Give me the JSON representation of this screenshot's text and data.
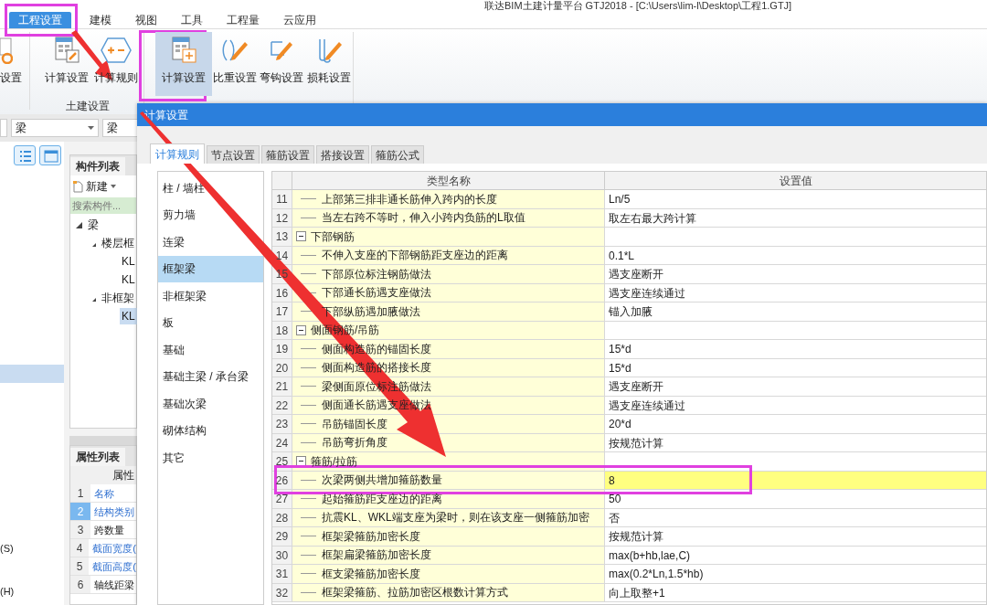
{
  "window": {
    "title": "联达BIM土建计量平台 GTJ2018 - [C:\\Users\\lim-l\\Desktop\\工程1.GTJ]"
  },
  "ribbon_tabs": [
    {
      "label": "工程设置",
      "selected": true
    },
    {
      "label": "建模",
      "selected": false
    },
    {
      "label": "视图",
      "selected": false
    },
    {
      "label": "工具",
      "selected": false
    },
    {
      "label": "工程量",
      "selected": false
    },
    {
      "label": "云应用",
      "selected": false
    }
  ],
  "ribbon_buttons": [
    {
      "label": "设置",
      "selected": false
    },
    {
      "label": "计算设置",
      "selected": false
    },
    {
      "label": "计算规则",
      "selected": false
    },
    {
      "label": "计算设置",
      "selected": true
    },
    {
      "label": "比重设置",
      "selected": false
    },
    {
      "label": "弯钩设置",
      "selected": false
    },
    {
      "label": "损耗设置",
      "selected": false
    }
  ],
  "ribbon_group_label": "土建设置",
  "combos": [
    "梁",
    "梁"
  ],
  "left_panel_fragments": [
    "(S)",
    "(H)"
  ],
  "component_list": {
    "tab": "构件列表",
    "new_button": "新建",
    "search": {
      "placeholder": "搜索构件..."
    },
    "tree": [
      {
        "label": "梁",
        "expanded": true,
        "selected": false,
        "children": [
          {
            "label": "楼层框",
            "expanded": true,
            "selected": false,
            "children": [
              {
                "label": "KL",
                "selected": false
              },
              {
                "label": "KL",
                "selected": false
              }
            ]
          },
          {
            "label": "非框架",
            "expanded": true,
            "selected": false,
            "children": [
              {
                "label": "KL",
                "selected": true
              }
            ]
          }
        ]
      }
    ]
  },
  "property_list": {
    "tab": "属性列表",
    "column": "属性",
    "rows": [
      {
        "num": "1",
        "name": "名称",
        "link": true,
        "selected": false
      },
      {
        "num": "2",
        "name": "结构类别",
        "link": true,
        "selected": true
      },
      {
        "num": "3",
        "name": "跨数量",
        "link": false,
        "selected": false
      },
      {
        "num": "4",
        "name": "截面宽度(",
        "link": true,
        "selected": false
      },
      {
        "num": "5",
        "name": "截面高度(",
        "link": true,
        "selected": false
      },
      {
        "num": "6",
        "name": "轴线距梁",
        "link": false,
        "selected": false
      }
    ]
  },
  "dialog": {
    "title": "计算设置",
    "tabs": [
      {
        "label": "计算规则",
        "selected": true
      },
      {
        "label": "节点设置",
        "selected": false
      },
      {
        "label": "箍筋设置",
        "selected": false
      },
      {
        "label": "搭接设置",
        "selected": false
      },
      {
        "label": "箍筋公式",
        "selected": false
      }
    ],
    "categories": [
      {
        "label": "柱 / 墙柱",
        "selected": false
      },
      {
        "label": "剪力墙",
        "selected": false
      },
      {
        "label": "连梁",
        "selected": false
      },
      {
        "label": "框架梁",
        "selected": true
      },
      {
        "label": "非框架梁",
        "selected": false
      },
      {
        "label": "板",
        "selected": false
      },
      {
        "label": "基础",
        "selected": false
      },
      {
        "label": "基础主梁 / 承台梁",
        "selected": false
      },
      {
        "label": "基础次梁",
        "selected": false
      },
      {
        "label": "砌体结构",
        "selected": false
      },
      {
        "label": "其它",
        "selected": false
      }
    ],
    "columns": [
      "类型名称",
      "设置值"
    ],
    "rows": [
      {
        "num": "11",
        "kind": "item",
        "name": "上部第三排非通长筋伸入跨内的长度",
        "value": "Ln/5",
        "selected": false
      },
      {
        "num": "12",
        "kind": "item",
        "name": "当左右跨不等时，伸入小跨内负筋的L取值",
        "value": "取左右最大跨计算",
        "selected": false
      },
      {
        "num": "13",
        "kind": "group",
        "name": "下部钢筋",
        "expanded": true
      },
      {
        "num": "14",
        "kind": "item",
        "name": "不伸入支座的下部钢筋距支座边的距离",
        "value": "0.1*L",
        "selected": false
      },
      {
        "num": "15",
        "kind": "item",
        "name": "下部原位标注钢筋做法",
        "value": "遇支座断开",
        "selected": false
      },
      {
        "num": "16",
        "kind": "item",
        "name": "下部通长筋遇支座做法",
        "value": "遇支座连续通过",
        "selected": false
      },
      {
        "num": "17",
        "kind": "item",
        "name": "下部纵筋遇加腋做法",
        "value": "锚入加腋",
        "selected": false
      },
      {
        "num": "18",
        "kind": "group",
        "name": "侧面钢筋/吊筋",
        "expanded": true
      },
      {
        "num": "19",
        "kind": "item",
        "name": "侧面构造筋的锚固长度",
        "value": "15*d",
        "selected": false
      },
      {
        "num": "20",
        "kind": "item",
        "name": "侧面构造筋的搭接长度",
        "value": "15*d",
        "selected": false
      },
      {
        "num": "21",
        "kind": "item",
        "name": "梁侧面原位标注筋做法",
        "value": "遇支座断开",
        "selected": false
      },
      {
        "num": "22",
        "kind": "item",
        "name": "侧面通长筋遇支座做法",
        "value": "遇支座连续通过",
        "selected": false
      },
      {
        "num": "23",
        "kind": "item",
        "name": "吊筋锚固长度",
        "value": "20*d",
        "selected": false
      },
      {
        "num": "24",
        "kind": "item",
        "name": "吊筋弯折角度",
        "value": "按规范计算",
        "selected": false
      },
      {
        "num": "25",
        "kind": "group",
        "name": "箍筋/拉筋",
        "expanded": true
      },
      {
        "num": "26",
        "kind": "item",
        "name": "次梁两侧共增加箍筋数量",
        "value": "8",
        "selected": true
      },
      {
        "num": "27",
        "kind": "item",
        "name": "起始箍筋距支座边的距离",
        "value": "50",
        "selected": false
      },
      {
        "num": "28",
        "kind": "item",
        "name": "抗震KL、WKL端支座为梁时，则在该支座一侧箍筋加密",
        "value": "否",
        "selected": false
      },
      {
        "num": "29",
        "kind": "item",
        "name": "框架梁箍筋加密长度",
        "value": "按规范计算",
        "selected": false
      },
      {
        "num": "30",
        "kind": "item",
        "name": "框架扁梁箍筋加密长度",
        "value": "max(b+hb,lae,C)",
        "selected": false
      },
      {
        "num": "31",
        "kind": "item",
        "name": "框支梁箍筋加密长度",
        "value": "max(0.2*Ln,1.5*hb)",
        "selected": false
      },
      {
        "num": "32",
        "kind": "item",
        "name": "框架梁箍筋、拉筋加密区根数计算方式",
        "value": "向上取整+1",
        "selected": false
      }
    ]
  }
}
